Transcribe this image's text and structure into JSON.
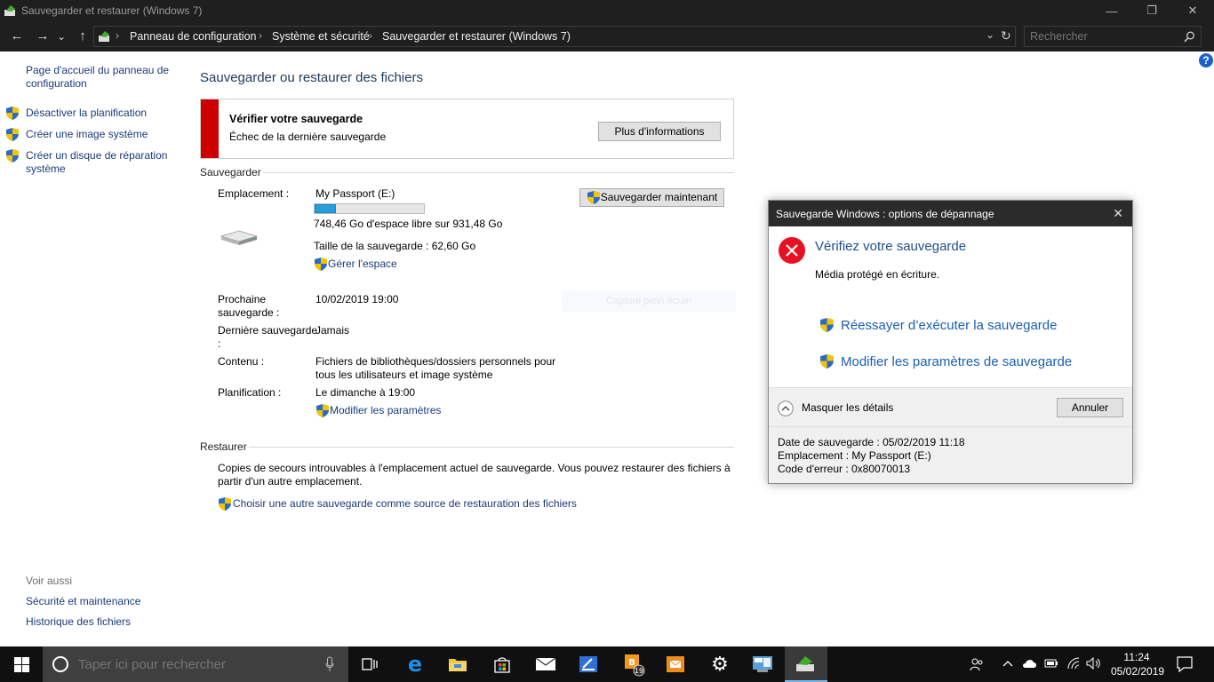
{
  "window": {
    "title": "Sauvegarder et restaurer (Windows 7)",
    "minimize": "—",
    "restore": "❐",
    "close": "✕"
  },
  "addressbar": {
    "back": "←",
    "forward": "→",
    "dropdown": "⌄",
    "up": "↑",
    "crumbs": [
      "Panneau de configuration",
      "Système et sécurité",
      "Sauvegarder et restaurer (Windows 7)"
    ],
    "separator": "›",
    "chevron": "⌄",
    "refresh": "↻",
    "search_placeholder": "Rechercher"
  },
  "help_icon": "?",
  "left_pane": {
    "home_link": [
      "Page d'accueil du panneau de",
      "configuration"
    ],
    "links": [
      "Désactiver la planification",
      "Créer une image système",
      [
        "Créer un disque de réparation",
        "système"
      ]
    ],
    "see_also_title": "Voir aussi",
    "see_also": [
      "Sécurité et maintenance",
      "Historique des fichiers"
    ]
  },
  "main": {
    "heading": "Sauvegarder ou restaurer des fichiers",
    "warning": {
      "title": "Vérifier votre sauvegarde",
      "message": "Échec de la dernière sauvegarde",
      "more_info": "Plus d'informations"
    },
    "backup": {
      "section": "Sauvegarder",
      "location_label": "Emplacement :",
      "location_value": "My Passport (E:)",
      "free_space_fraction": 0.196,
      "free_space": "748,46 Go d'espace libre sur 931,48 Go",
      "backup_size": "Taille de la sauvegarde : 62,60 Go",
      "manage_space": "Gérer l'espace",
      "backup_now": "Sauvegarder maintenant",
      "next_label": [
        "Prochaine",
        "sauvegarde :"
      ],
      "next_value": "10/02/2019 19:00",
      "last_label": [
        "Dernière sauvegarde",
        ":"
      ],
      "last_value": "Jamais",
      "content_label": "Contenu :",
      "content_value": [
        "Fichiers de bibliothèques/dossiers personnels pour",
        "tous les utilisateurs et image système"
      ],
      "schedule_label": "Planification :",
      "schedule_value": "Le dimanche à 19:00",
      "change_settings": "Modifier les paramètres",
      "watermark": "Capture plein écran"
    },
    "restore": {
      "section": "Restaurer",
      "text": [
        "Copies de secours introuvables à l'emplacement actuel de sauvegarde. Vous pouvez restaurer des fichiers à",
        "partir d'un autre emplacement."
      ],
      "choose_link": "Choisir une autre sauvegarde comme source de restauration des fichiers"
    }
  },
  "dialog": {
    "title": "Sauvegarde Windows : options de dépannage",
    "close": "✕",
    "heading": "Vérifiez votre sauvegarde",
    "message": "Média protégé en écriture.",
    "retry": "Réessayer d’exécuter la sauvegarde",
    "modify": "Modifier les paramètres de sauvegarde",
    "hide_details": "Masquer les détails",
    "cancel": "Annuler",
    "details": [
      "Date de sauvegarde : 05/02/2019 11:18",
      "Emplacement : My Passport (E:)",
      "Code d'erreur : 0x80070013"
    ]
  },
  "taskbar": {
    "search_placeholder": "Taper ici pour rechercher",
    "badge_count": "19",
    "time": "11:24",
    "date": "05/02/2019"
  },
  "colors": {
    "titlebar": "#1f1f1f",
    "link": "#1b3a7a",
    "heading": "#1e395b",
    "dialog_link": "#1a5fb4",
    "error_red": "#e81123",
    "warn_bar": "#cc0000",
    "progress": "#26a0da"
  }
}
